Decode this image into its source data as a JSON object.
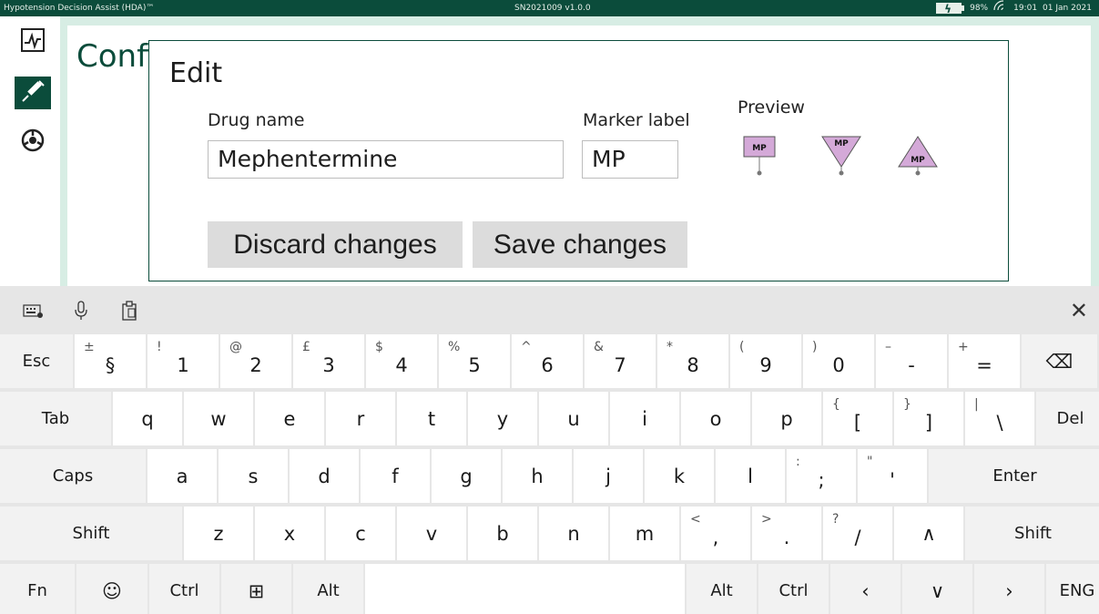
{
  "statusbar": {
    "app_title": "Hypotension Decision Assist (HDA)™",
    "serial": "SN2021009 v1.0.0",
    "battery": "98%",
    "time": "19:01",
    "date": "01 Jan 2021"
  },
  "sidebar": {
    "items": [
      {
        "icon": "monitor-icon"
      },
      {
        "icon": "syringe-icon"
      },
      {
        "icon": "settings-icon"
      }
    ]
  },
  "page": {
    "title": "Confi"
  },
  "dialog": {
    "title": "Edit",
    "drug_name_label": "Drug name",
    "drug_name_value": "Mephentermine",
    "marker_label_label": "Marker label",
    "marker_label_value": "MP",
    "preview_label": "Preview",
    "preview_marker_text": "MP",
    "discard_label": "Discard changes",
    "save_label": "Save changes",
    "colors": {
      "accent": "#0b4c3b",
      "marker_fill": "#d4a9d8"
    }
  },
  "keyboard": {
    "toolbar": [
      "keyboard-settings-icon",
      "microphone-icon",
      "clipboard-icon",
      "close-icon"
    ],
    "close_glyph": "✕",
    "rows": [
      [
        {
          "p": "Esc"
        },
        {
          "p": "§",
          "s": "±"
        },
        {
          "p": "1",
          "s": "!"
        },
        {
          "p": "2",
          "s": "@"
        },
        {
          "p": "3",
          "s": "£"
        },
        {
          "p": "4",
          "s": "$"
        },
        {
          "p": "5",
          "s": "%"
        },
        {
          "p": "6",
          "s": "^"
        },
        {
          "p": "7",
          "s": "&"
        },
        {
          "p": "8",
          "s": "*"
        },
        {
          "p": "9",
          "s": "("
        },
        {
          "p": "0",
          "s": ")"
        },
        {
          "p": "-",
          "s": "–"
        },
        {
          "p": "=",
          "s": "+"
        },
        {
          "p": "⌫"
        }
      ],
      [
        {
          "p": "Tab"
        },
        {
          "p": "q"
        },
        {
          "p": "w"
        },
        {
          "p": "e"
        },
        {
          "p": "r"
        },
        {
          "p": "t"
        },
        {
          "p": "y"
        },
        {
          "p": "u"
        },
        {
          "p": "i"
        },
        {
          "p": "o"
        },
        {
          "p": "p"
        },
        {
          "p": "[",
          "s": "{"
        },
        {
          "p": "]",
          "s": "}"
        },
        {
          "p": "\\",
          "s": "|"
        },
        {
          "p": "Del"
        }
      ],
      [
        {
          "p": "Caps"
        },
        {
          "p": "a"
        },
        {
          "p": "s"
        },
        {
          "p": "d"
        },
        {
          "p": "f"
        },
        {
          "p": "g"
        },
        {
          "p": "h"
        },
        {
          "p": "j"
        },
        {
          "p": "k"
        },
        {
          "p": "l"
        },
        {
          "p": ";",
          "s": ":"
        },
        {
          "p": "'",
          "s": "\""
        },
        {
          "p": "Enter"
        }
      ],
      [
        {
          "p": "Shift"
        },
        {
          "p": "z"
        },
        {
          "p": "x"
        },
        {
          "p": "c"
        },
        {
          "p": "v"
        },
        {
          "p": "b"
        },
        {
          "p": "n"
        },
        {
          "p": "m"
        },
        {
          "p": ",",
          "s": "<"
        },
        {
          "p": ".",
          "s": ">"
        },
        {
          "p": "/",
          "s": "?"
        },
        {
          "p": "∧"
        },
        {
          "p": "Shift"
        }
      ],
      [
        {
          "p": "Fn"
        },
        {
          "p": "☺"
        },
        {
          "p": "Ctrl"
        },
        {
          "p": "⊞"
        },
        {
          "p": "Alt"
        },
        {
          "p": ""
        },
        {
          "p": "Alt"
        },
        {
          "p": "Ctrl"
        },
        {
          "p": "‹"
        },
        {
          "p": "∨"
        },
        {
          "p": "›"
        },
        {
          "p": "ENG"
        }
      ]
    ]
  }
}
